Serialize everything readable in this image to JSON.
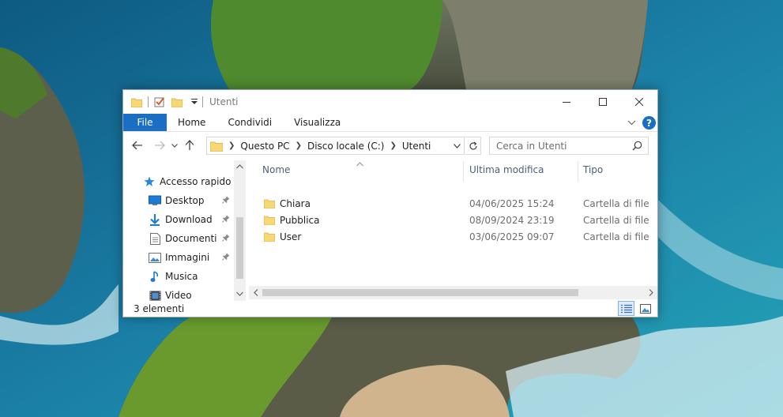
{
  "window": {
    "title": "Utenti",
    "controls": {
      "minimize": "minimize-icon",
      "maximize": "maximize-icon",
      "close": "close-icon"
    }
  },
  "ribbon": {
    "tabs": [
      "File",
      "Home",
      "Condividi",
      "Visualizza"
    ],
    "help": "?"
  },
  "address": {
    "breadcrumb": [
      "Questo PC",
      "Disco locale (C:)",
      "Utenti"
    ]
  },
  "search": {
    "placeholder": "Cerca in Utenti"
  },
  "navpane": {
    "items": [
      {
        "label": "Accesso rapido",
        "icon": "star-icon",
        "pinned": false
      },
      {
        "label": "Desktop",
        "icon": "desktop-icon",
        "pinned": true
      },
      {
        "label": "Download",
        "icon": "download-icon",
        "pinned": true
      },
      {
        "label": "Documenti",
        "icon": "documents-icon",
        "pinned": true
      },
      {
        "label": "Immagini",
        "icon": "pictures-icon",
        "pinned": true
      },
      {
        "label": "Musica",
        "icon": "music-icon",
        "pinned": false
      },
      {
        "label": "Video",
        "icon": "video-icon",
        "pinned": false
      }
    ]
  },
  "filelist": {
    "columns": [
      "Nome",
      "Ultima modifica",
      "Tipo"
    ],
    "rows": [
      {
        "name": "Chiara",
        "modified": "04/06/2025 15:24",
        "type": "Cartella di file"
      },
      {
        "name": "Pubblica",
        "modified": "08/09/2024 23:19",
        "type": "Cartella di file"
      },
      {
        "name": "User",
        "modified": "03/06/2025 09:07",
        "type": "Cartella di file"
      }
    ]
  },
  "status": {
    "count": "3 elementi"
  },
  "colors": {
    "accent": "#1a6fc4",
    "folder": "#f8d775",
    "header_text": "#4c607a"
  }
}
